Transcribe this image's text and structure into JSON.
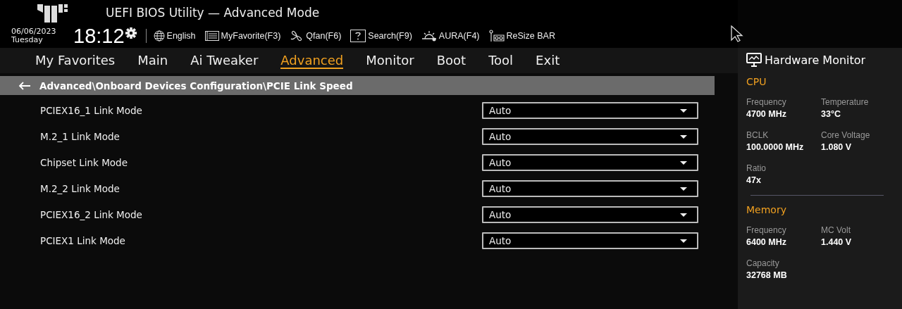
{
  "window": {
    "title": "UEFI BIOS Utility — Advanced Mode"
  },
  "clock": {
    "date": "06/06/2023",
    "weekday": "Tuesday",
    "time": "18:12"
  },
  "toolbar": [
    {
      "kind": "language",
      "label": "English"
    },
    {
      "kind": "favorite",
      "label": "MyFavorite(F3)"
    },
    {
      "kind": "fan",
      "label": "Qfan(F6)"
    },
    {
      "kind": "search",
      "label": "Search(F9)"
    },
    {
      "kind": "aura",
      "label": "AURA(F4)"
    },
    {
      "kind": "resize",
      "label": "ReSize BAR"
    }
  ],
  "tabs": [
    {
      "label": "My Favorites",
      "selected": false
    },
    {
      "label": "Main",
      "selected": false
    },
    {
      "label": "Ai Tweaker",
      "selected": false
    },
    {
      "label": "Advanced",
      "selected": true
    },
    {
      "label": "Monitor",
      "selected": false
    },
    {
      "label": "Boot",
      "selected": false
    },
    {
      "label": "Tool",
      "selected": false
    },
    {
      "label": "Exit",
      "selected": false
    }
  ],
  "breadcrumb": "Advanced\\Onboard Devices Configuration\\PCIE Link Speed",
  "settings": [
    {
      "label": "PCIEX16_1 Link Mode",
      "value": "Auto"
    },
    {
      "label": "M.2_1 Link Mode",
      "value": "Auto"
    },
    {
      "label": "Chipset Link Mode",
      "value": "Auto"
    },
    {
      "label": "M.2_2 Link Mode",
      "value": "Auto"
    },
    {
      "label": "PCIEX16_2 Link Mode",
      "value": "Auto"
    },
    {
      "label": "PCIEX1 Link Mode",
      "value": "Auto"
    }
  ],
  "hardware_monitor": {
    "title": "Hardware Monitor",
    "sections": [
      {
        "title": "CPU",
        "items": [
          {
            "label": "Frequency",
            "value": "4700 MHz"
          },
          {
            "label": "Temperature",
            "value": "33°C"
          },
          {
            "label": "BCLK",
            "value": "100.0000 MHz"
          },
          {
            "label": "Core Voltage",
            "value": "1.080 V"
          },
          {
            "label": "Ratio",
            "value": "47x"
          }
        ]
      },
      {
        "title": "Memory",
        "items": [
          {
            "label": "Frequency",
            "value": "6400 MHz"
          },
          {
            "label": "MC Volt",
            "value": "1.440 V"
          },
          {
            "label": "Capacity",
            "value": "32768 MB"
          }
        ]
      }
    ]
  }
}
